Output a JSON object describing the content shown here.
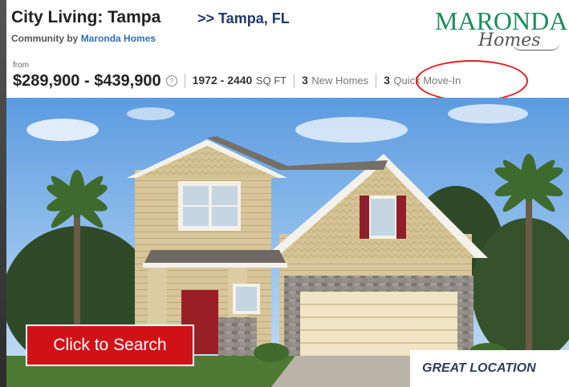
{
  "header": {
    "title": "City Living: Tampa",
    "location_link": ">> Tampa, FL",
    "community_prefix": "Community by",
    "builder_link": "Maronda Homes",
    "logo_main": "MARONDA",
    "logo_sub": "Homes"
  },
  "stats": {
    "from_label": "from",
    "price_range": "$289,900 - $439,900",
    "info_icon": "?",
    "sqft_value": "1972 - 2440",
    "sqft_unit": "SQ FT",
    "new_homes_count": "3",
    "new_homes_label": "New Homes",
    "quick_move_in_count": "3",
    "quick_move_in_label": "Quick Move-In"
  },
  "cta": {
    "label": "Click to Search"
  },
  "banner": {
    "text": "GREAT LOCATION"
  },
  "colors": {
    "accent_red": "#d01218",
    "link_blue": "#2f6fb7",
    "location_navy": "#1e3a6e",
    "logo_green": "#1c8c5c",
    "highlight_circle": "#e0201f"
  }
}
